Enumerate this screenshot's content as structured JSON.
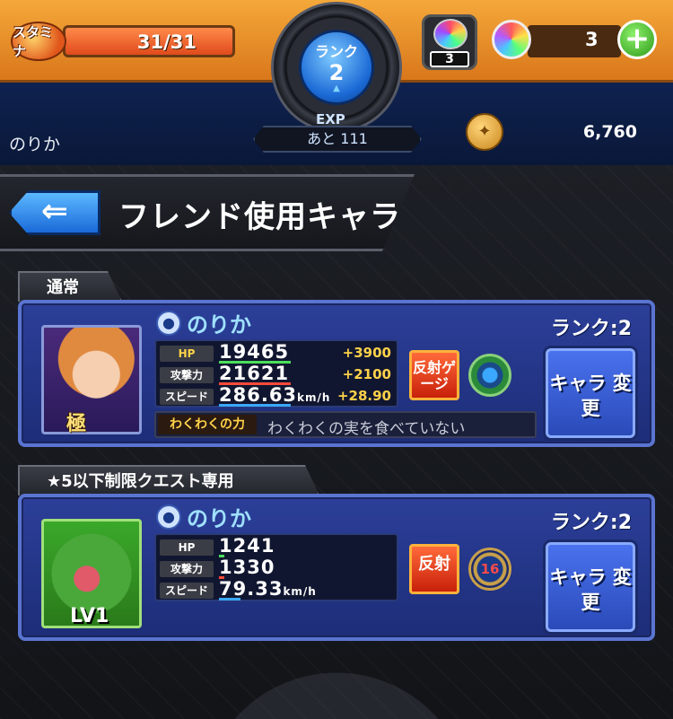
{
  "colors": {
    "top_bar": "#e58a28",
    "panel_blue": "#2c3f99",
    "name_cyan": "#9fe0ff",
    "bonus_yellow": "#ffd24a",
    "hp_green": "#4adf5a",
    "atk_red": "#ff4a3a",
    "spd_blue": "#3aa8ff"
  },
  "topbar": {
    "stamina_icon_text": "スタミナ",
    "stamina": "31/31",
    "stamina_fraction": 1.0,
    "gem_count": "3",
    "orb_count": "3",
    "plus_label": "+"
  },
  "rank": {
    "label": "ランク",
    "value": "2"
  },
  "player": {
    "name": "のりか",
    "exp_label": "EXP",
    "exp_remaining": "あと 111",
    "coins": "6,760"
  },
  "header": {
    "back_icon": "back-arrow-icon",
    "title": "フレンド使用キャラ"
  },
  "sections": [
    {
      "label": "通常",
      "user_name": "のりか",
      "rank_text": "ランク:2",
      "portrait_badge": "極",
      "stats": {
        "hp_label": "HP",
        "hp": "19465",
        "hp_bonus": "+3900",
        "atk_label": "攻撃力",
        "atk": "21621",
        "atk_bonus": "+2100",
        "spd_label": "スピード",
        "spd": "286.63",
        "spd_unit": "km/h",
        "spd_bonus": "+28.90"
      },
      "waku_label": "わくわくの力",
      "waku_value": "わくわくの実を食べていない",
      "ability": "反射ゲージ",
      "change_button": "キャラ 変更"
    },
    {
      "label": "★5以下制限クエスト専用",
      "user_name": "のりか",
      "rank_text": "ランク:2",
      "level": "LV1",
      "stats": {
        "hp_label": "HP",
        "hp": "1241",
        "atk_label": "攻撃力",
        "atk": "1330",
        "spd_label": "スピード",
        "spd": "79.33",
        "spd_unit": "km/h"
      },
      "ability": "反射",
      "luck": "16",
      "change_button": "キャラ 変更"
    }
  ]
}
